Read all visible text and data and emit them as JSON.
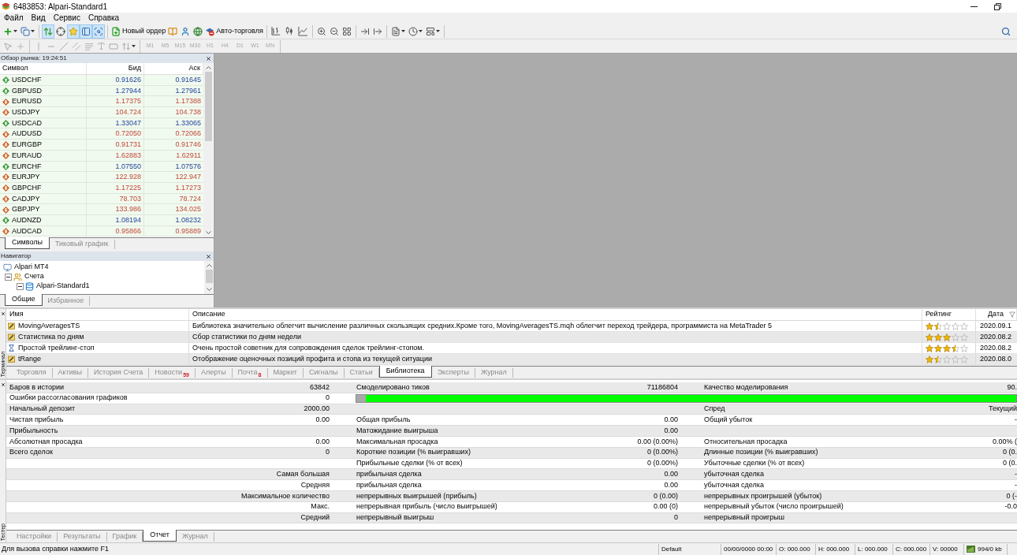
{
  "window": {
    "title": "6483853: Alpari-Standard1"
  },
  "menu": [
    "Файл",
    "Вид",
    "Сервис",
    "Справка"
  ],
  "toolbar": {
    "view_toggles": [
      {
        "pressed": true
      },
      {
        "pressed": false
      },
      {
        "pressed": true
      },
      {
        "pressed": true
      },
      {
        "pressed": true
      }
    ],
    "new_order": "Новый ордер",
    "auto_trading": "Авто-торговля",
    "drawing_tools_disabled": true,
    "periods": [
      {
        "label": "M1",
        "disabled": true
      },
      {
        "label": "M5",
        "disabled": true
      },
      {
        "label": "M15",
        "disabled": true
      },
      {
        "label": "M30",
        "disabled": true
      },
      {
        "label": "H1",
        "disabled": true
      },
      {
        "label": "H4",
        "disabled": true
      },
      {
        "label": "D1",
        "disabled": true
      },
      {
        "label": "W1",
        "disabled": true
      },
      {
        "label": "MN",
        "disabled": true
      }
    ]
  },
  "market_watch": {
    "title": "Обзор рынка: 19:24:51",
    "columns": [
      "Символ",
      "Бид",
      "Аск"
    ],
    "rows": [
      {
        "symbol": "USDCHF",
        "bid": "0.91626",
        "ask": "0.91645",
        "kind": "up"
      },
      {
        "symbol": "GBPUSD",
        "bid": "1.27944",
        "ask": "1.27961",
        "kind": "up"
      },
      {
        "symbol": "EURUSD",
        "bid": "1.17375",
        "ask": "1.17388",
        "kind": "down"
      },
      {
        "symbol": "USDJPY",
        "bid": "104.724",
        "ask": "104.738",
        "kind": "down"
      },
      {
        "symbol": "USDCAD",
        "bid": "1.33047",
        "ask": "1.33065",
        "kind": "up"
      },
      {
        "symbol": "AUDUSD",
        "bid": "0.72050",
        "ask": "0.72066",
        "kind": "down"
      },
      {
        "symbol": "EURGBP",
        "bid": "0.91731",
        "ask": "0.91746",
        "kind": "down"
      },
      {
        "symbol": "EURAUD",
        "bid": "1.62883",
        "ask": "1.62911",
        "kind": "down"
      },
      {
        "symbol": "EURCHF",
        "bid": "1.07550",
        "ask": "1.07576",
        "kind": "up"
      },
      {
        "symbol": "EURJPY",
        "bid": "122.928",
        "ask": "122.947",
        "kind": "down"
      },
      {
        "symbol": "GBPCHF",
        "bid": "1.17225",
        "ask": "1.17273",
        "kind": "down"
      },
      {
        "symbol": "CADJPY",
        "bid": "78.703",
        "ask": "78.724",
        "kind": "down"
      },
      {
        "symbol": "GBPJPY",
        "bid": "133.986",
        "ask": "134.025",
        "kind": "down"
      },
      {
        "symbol": "AUDNZD",
        "bid": "1.08194",
        "ask": "1.08232",
        "kind": "up"
      },
      {
        "symbol": "AUDCAD",
        "bid": "0.95866",
        "ask": "0.95889",
        "kind": "down"
      }
    ],
    "tabs": [
      {
        "label": "Символы",
        "selected": true
      },
      {
        "label": "Тиковый график",
        "selected": false
      }
    ]
  },
  "navigator": {
    "title": "Навигатор",
    "tree": [
      {
        "label": "Alpari MT4",
        "kind": "terminal",
        "children": [
          {
            "label": "Счета",
            "kind": "accounts",
            "expanded": true,
            "children": [
              {
                "label": "Alpari-Standard1",
                "kind": "server",
                "expanded": true
              }
            ]
          }
        ]
      }
    ],
    "tabs": [
      {
        "label": "Общие",
        "selected": true
      },
      {
        "label": "Избранное",
        "selected": false
      }
    ]
  },
  "terminal": {
    "side_label": "Терминал",
    "columns": [
      "Имя",
      "Описание",
      "Рейтинг",
      "Дата"
    ],
    "rows": [
      {
        "kind": "script",
        "name": "MovingAveragesTS",
        "description": "Библиотека значительно облегчит вычисление различных скользящих средних.Кроме того, MovingAveragesTS.mqh облегчит переход трейдера, программиста на MetaTrader 5",
        "stars": 1.5,
        "date": "2020.09.1"
      },
      {
        "kind": "script",
        "name": "Статистика по дням",
        "description": "Сбор статистики по дням недели",
        "stars": 3,
        "date": "2020.08.2"
      },
      {
        "kind": "expert",
        "name": "Простой трейлинг-стоп",
        "description": "Очень простой советник для сопровождения сделок трейлинг-стопом.",
        "stars": 3.5,
        "date": "2020.08.2"
      },
      {
        "kind": "script",
        "name": "tRange",
        "description": "Отображение оценочных позиций профита и стопа из текущей ситуации",
        "stars": 1.5,
        "date": "2020.08.0"
      }
    ],
    "tabs": [
      {
        "label": "Торговля",
        "selected": false
      },
      {
        "label": "Активы",
        "selected": false
      },
      {
        "label": "История Счета",
        "selected": false
      },
      {
        "label": "Новости",
        "badge": "59",
        "selected": false
      },
      {
        "label": "Алерты",
        "selected": false
      },
      {
        "label": "Почта",
        "badge": "8",
        "selected": false
      },
      {
        "label": "Маркет",
        "selected": false
      },
      {
        "label": "Сигналы",
        "selected": false
      },
      {
        "label": "Статьи",
        "selected": false
      },
      {
        "label": "Библиотека",
        "selected": true
      },
      {
        "label": "Эксперты",
        "selected": false
      },
      {
        "label": "Журнал",
        "selected": false
      }
    ]
  },
  "tester": {
    "side_label": "Тестер",
    "rows": [
      {
        "label_1": "Баров в истории",
        "value_1": "63842",
        "label_2": "Смоделировано тиков",
        "value_2": "71186804",
        "label_3": "Качество моделирования",
        "value_3": "90."
      },
      {
        "label_1": "Ошибки рассогласования графиков",
        "value_1": "0",
        "quality_bar": {
          "level": 0.986
        }
      },
      {
        "label_1": "Начальный депозит",
        "value_1": "2000.00",
        "label_3": "Спред",
        "value_3": "Текущий"
      },
      {
        "label_1": "Чистая прибыль",
        "value_1": "0.00",
        "label_2": "Общая прибыль",
        "value_2": "0.00",
        "label_3": "Общий убыток",
        "value_3": "-"
      },
      {
        "label_1": "Прибыльность",
        "label_2": "Матожидание выигрыша",
        "value_2": "0.00"
      },
      {
        "label_1": "Абсолютная просадка",
        "value_1": "0.00",
        "label_2": "Максимальная просадка",
        "value_2": "0.00 (0.00%)",
        "label_3": "Относительная просадка",
        "value_3": "0.00% ("
      },
      {
        "label_1": "Всего сделок",
        "value_1": "0",
        "label_2": "Короткие позиции (% выигравших)",
        "value_2": "0 (0.00%)",
        "label_3": "Длинные позиции (% выигравших)",
        "value_3": "0 (0."
      },
      {
        "label_2": "Прибыльные сделки (% от всех)",
        "value_2": "0 (0.00%)",
        "label_3": "Убыточные сделки (% от всех)",
        "value_3": "0 (0."
      },
      {
        "value_1": "Самая большая",
        "label_2": "прибыльная сделка",
        "value_2": "0.00",
        "label_3": "убыточная сделка",
        "value_3": "-"
      },
      {
        "value_1": "Средняя",
        "label_2": "прибыльная сделка",
        "value_2": "0.00",
        "label_3": "убыточная сделка",
        "value_3": "-"
      },
      {
        "value_1": "Максимальное количество",
        "label_2": "непрерывных выигрышей (прибыль)",
        "value_2": "0 (0.00)",
        "label_3": "непрерывных проигрышей (убыток)",
        "value_3": "0 (-"
      },
      {
        "value_1": "Макс.",
        "label_2": "непрерывная прибыль (число выигрышей)",
        "value_2": "0.00 (0)",
        "label_3": "непрерывный убыток (число проигрышей)",
        "value_3": "-0.0"
      },
      {
        "value_1": "Средний",
        "label_2": "непрерывный выигрыш",
        "value_2": "0",
        "label_3": "непрерывный проигрыш"
      }
    ],
    "tabs": [
      {
        "label": "Настройки",
        "selected": false
      },
      {
        "label": "Результаты",
        "selected": false
      },
      {
        "label": "График",
        "selected": false
      },
      {
        "label": "Отчет",
        "selected": true
      },
      {
        "label": "Журнал",
        "selected": false
      }
    ]
  },
  "status_bar": {
    "hint": "Для вызова справки нажмите F1",
    "fields": [
      "Default",
      "00/00/0000 00:00",
      "O: 000.000",
      "H: 000.000",
      "L: 000.000",
      "C: 000.000",
      "V: 00000"
    ],
    "traffic": "994/0 kb"
  }
}
